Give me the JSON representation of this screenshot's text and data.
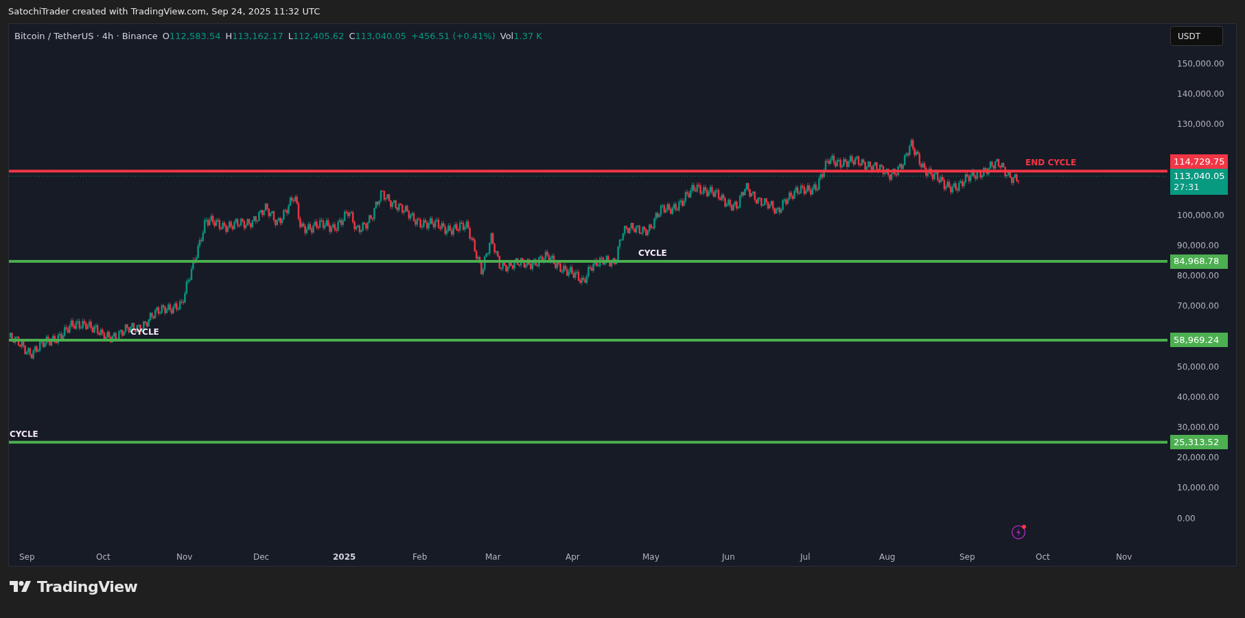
{
  "attribution": "SatochiTrader created with TradingView.com, Sep 24, 2025 11:32 UTC",
  "legend": {
    "symbol": "Bitcoin / TetherUS · 4h · Binance",
    "ohlc": [
      {
        "label": "O",
        "value": "112,583.54"
      },
      {
        "label": "H",
        "value": "113,162.17"
      },
      {
        "label": "L",
        "value": "112,405.62"
      },
      {
        "label": "C",
        "value": "113,040.05"
      }
    ],
    "change": "+456.51 (+0.41%)",
    "volume": {
      "label": "Vol",
      "value": "1.37 K"
    }
  },
  "currency_button": "USDT",
  "price_axis": {
    "ticks": [
      "150,000.00",
      "140,000.00",
      "130,000.00",
      "100,000.00",
      "90,000.00",
      "80,000.00",
      "70,000.00",
      "50,000.00",
      "40,000.00",
      "30,000.00",
      "20,000.00",
      "10,000.00",
      "0.00"
    ]
  },
  "time_axis": {
    "labels": [
      {
        "text": "Sep",
        "bold": false
      },
      {
        "text": "Oct",
        "bold": false
      },
      {
        "text": "Nov",
        "bold": false
      },
      {
        "text": "Dec",
        "bold": false
      },
      {
        "text": "2025",
        "bold": true
      },
      {
        "text": "Feb",
        "bold": false
      },
      {
        "text": "Mar",
        "bold": false
      },
      {
        "text": "Apr",
        "bold": false
      },
      {
        "text": "May",
        "bold": false
      },
      {
        "text": "Jun",
        "bold": false
      },
      {
        "text": "Jul",
        "bold": false
      },
      {
        "text": "Aug",
        "bold": false
      },
      {
        "text": "Sep",
        "bold": false
      },
      {
        "text": "Oct",
        "bold": false
      },
      {
        "text": "Nov",
        "bold": false
      }
    ]
  },
  "levels": [
    {
      "price_label": "114,729.75",
      "color": "#f23645",
      "caption": "END CYCLE",
      "kind": "resistance"
    },
    {
      "price_label": "84,968.78",
      "color": "#4caf50",
      "caption": "CYCLE",
      "kind": "support"
    },
    {
      "price_label": "58,969.24",
      "color": "#4caf50",
      "caption": "CYCLE",
      "kind": "support"
    },
    {
      "price_label": "25,313.52",
      "color": "#4caf50",
      "caption": "CYCLE",
      "kind": "support"
    }
  ],
  "last_price": {
    "value": "113,040.05",
    "countdown": "27:31"
  },
  "brand": "TradingView"
}
